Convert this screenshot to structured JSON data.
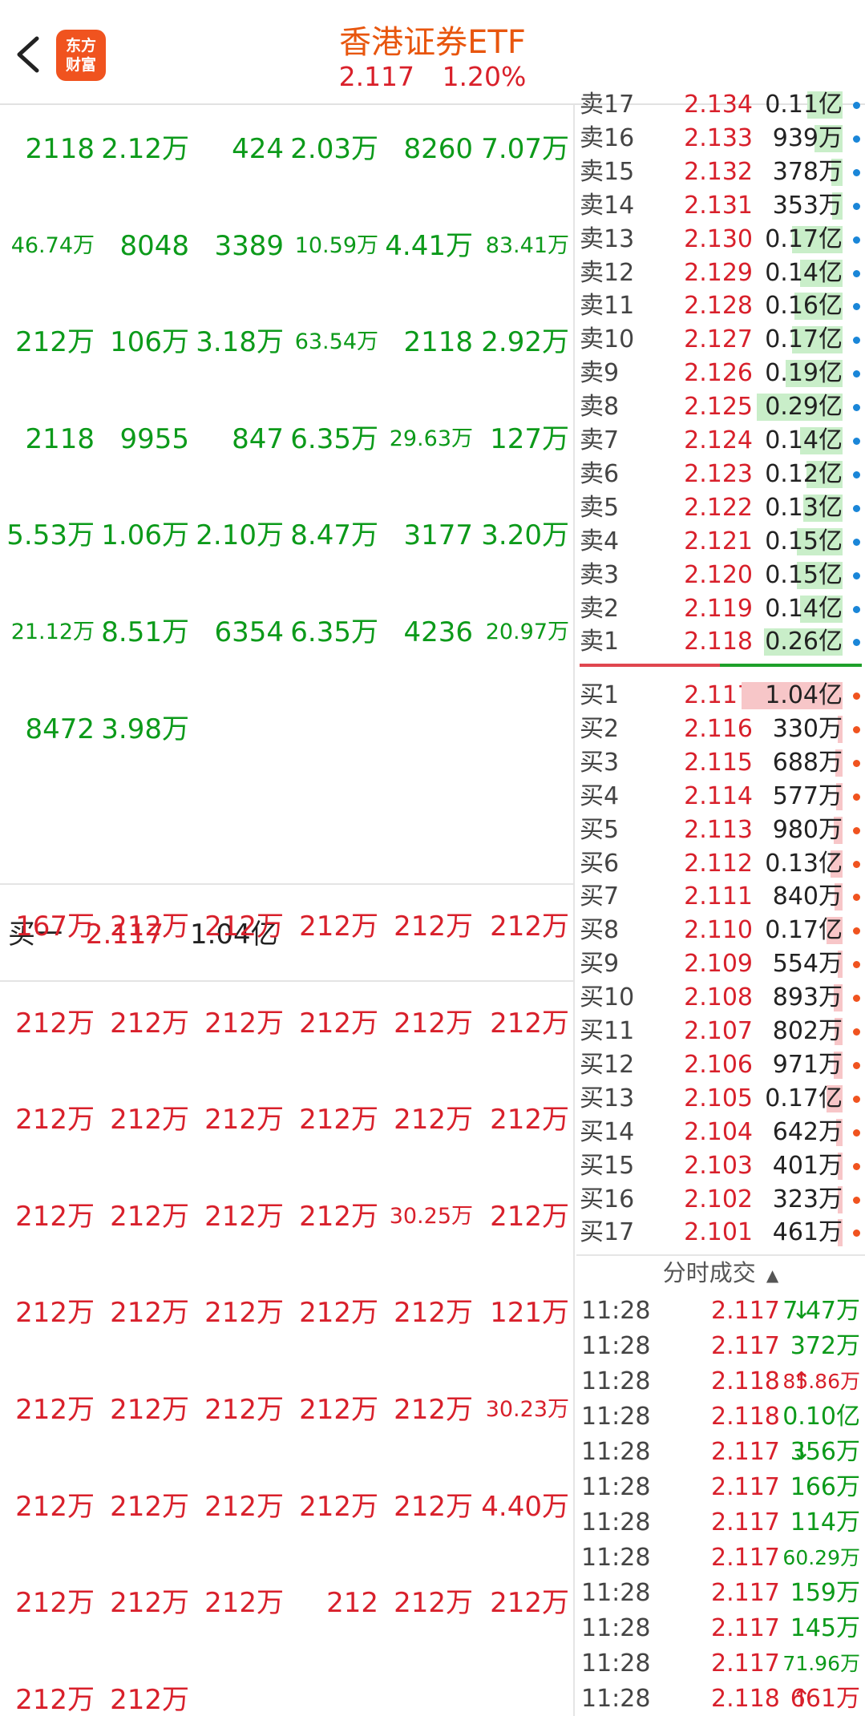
{
  "header": {
    "title": "香港证券ETF",
    "price": "2.117",
    "change_pct": "1.20%",
    "logo_text": [
      "东方",
      "财富"
    ]
  },
  "colors": {
    "up": "#d8202b",
    "down": "#0c9a1a",
    "accent": "#f0531f",
    "sell_dot": "#1a86d8"
  },
  "icons": {
    "back": "chevron-left-icon"
  },
  "sell_queue": [
    [
      "2118",
      "2.12万",
      "424",
      "2.03万",
      "8260",
      "7.07万"
    ],
    [
      "46.74万",
      "8048",
      "3389",
      "10.59万",
      "4.41万",
      "83.41万"
    ],
    [
      "212万",
      "106万",
      "3.18万",
      "63.54万",
      "2118",
      "2.92万"
    ],
    [
      "2118",
      "9955",
      "847",
      "6.35万",
      "29.63万",
      "127万"
    ],
    [
      "5.53万",
      "1.06万",
      "2.10万",
      "8.47万",
      "3177",
      "3.20万"
    ],
    [
      "21.12万",
      "8.51万",
      "6354",
      "6.35万",
      "4236",
      "20.97万"
    ],
    [
      "8472",
      "3.98万"
    ]
  ],
  "buy_one": {
    "label": "买一",
    "price": "2.117",
    "volume": "1.04亿"
  },
  "buy_queue": [
    [
      "167万",
      "212万",
      "212万",
      "212万",
      "212万",
      "212万"
    ],
    [
      "212万",
      "212万",
      "212万",
      "212万",
      "212万",
      "212万"
    ],
    [
      "212万",
      "212万",
      "212万",
      "212万",
      "212万",
      "212万"
    ],
    [
      "212万",
      "212万",
      "212万",
      "212万",
      "30.25万",
      "212万"
    ],
    [
      "212万",
      "212万",
      "212万",
      "212万",
      "212万",
      "121万"
    ],
    [
      "212万",
      "212万",
      "212万",
      "212万",
      "212万",
      "30.23万"
    ],
    [
      "212万",
      "212万",
      "212万",
      "212万",
      "212万",
      "4.40万"
    ],
    [
      "212万",
      "212万",
      "212万",
      "212",
      "212万",
      "212万"
    ],
    [
      "212万",
      "212万"
    ]
  ],
  "order_book": {
    "asks": [
      {
        "label": "卖17",
        "price": "2.134",
        "volume": "0.11亿",
        "level": 0.35
      },
      {
        "label": "卖16",
        "price": "2.133",
        "volume": "939万",
        "level": 0.28
      },
      {
        "label": "卖15",
        "price": "2.132",
        "volume": "378万",
        "level": 0.11
      },
      {
        "label": "卖14",
        "price": "2.131",
        "volume": "353万",
        "level": 0.1
      },
      {
        "label": "卖13",
        "price": "2.130",
        "volume": "0.17亿",
        "level": 0.5
      },
      {
        "label": "卖12",
        "price": "2.129",
        "volume": "0.14亿",
        "level": 0.42
      },
      {
        "label": "卖11",
        "price": "2.128",
        "volume": "0.16亿",
        "level": 0.48
      },
      {
        "label": "卖10",
        "price": "2.127",
        "volume": "0.17亿",
        "level": 0.5
      },
      {
        "label": "卖9",
        "price": "2.126",
        "volume": "0.19亿",
        "level": 0.56
      },
      {
        "label": "卖8",
        "price": "2.125",
        "volume": "0.29亿",
        "level": 0.85
      },
      {
        "label": "卖7",
        "price": "2.124",
        "volume": "0.14亿",
        "level": 0.42
      },
      {
        "label": "卖6",
        "price": "2.123",
        "volume": "0.12亿",
        "level": 0.36
      },
      {
        "label": "卖5",
        "price": "2.122",
        "volume": "0.13亿",
        "level": 0.39
      },
      {
        "label": "卖4",
        "price": "2.121",
        "volume": "0.15亿",
        "level": 0.45
      },
      {
        "label": "卖3",
        "price": "2.120",
        "volume": "0.15亿",
        "level": 0.45
      },
      {
        "label": "卖2",
        "price": "2.119",
        "volume": "0.14亿",
        "level": 0.42
      },
      {
        "label": "卖1",
        "price": "2.118",
        "volume": "0.26亿",
        "level": 0.78
      }
    ],
    "bids": [
      {
        "label": "买1",
        "price": "2.117",
        "volume": "1.04亿",
        "level": 1.0
      },
      {
        "label": "买2",
        "price": "2.116",
        "volume": "330万",
        "level": 0.03
      },
      {
        "label": "买3",
        "price": "2.115",
        "volume": "688万",
        "level": 0.07
      },
      {
        "label": "买4",
        "price": "2.114",
        "volume": "577万",
        "level": 0.06
      },
      {
        "label": "买5",
        "price": "2.113",
        "volume": "980万",
        "level": 0.09
      },
      {
        "label": "买6",
        "price": "2.112",
        "volume": "0.13亿",
        "level": 0.12
      },
      {
        "label": "买7",
        "price": "2.111",
        "volume": "840万",
        "level": 0.08
      },
      {
        "label": "买8",
        "price": "2.110",
        "volume": "0.17亿",
        "level": 0.16
      },
      {
        "label": "买9",
        "price": "2.109",
        "volume": "554万",
        "level": 0.05
      },
      {
        "label": "买10",
        "price": "2.108",
        "volume": "893万",
        "level": 0.09
      },
      {
        "label": "买11",
        "price": "2.107",
        "volume": "802万",
        "level": 0.08
      },
      {
        "label": "买12",
        "price": "2.106",
        "volume": "971万",
        "level": 0.09
      },
      {
        "label": "买13",
        "price": "2.105",
        "volume": "0.17亿",
        "level": 0.16
      },
      {
        "label": "买14",
        "price": "2.104",
        "volume": "642万",
        "level": 0.06
      },
      {
        "label": "买15",
        "price": "2.103",
        "volume": "401万",
        "level": 0.04
      },
      {
        "label": "买16",
        "price": "2.102",
        "volume": "323万",
        "level": 0.03
      },
      {
        "label": "买17",
        "price": "2.101",
        "volume": "461万",
        "level": 0.04
      }
    ]
  },
  "trades": {
    "header": "分时成交",
    "header_icon": "caret-up-icon",
    "rows": [
      {
        "time": "11:28",
        "price": "2.117",
        "dir": "down",
        "volume": "7.47万",
        "small": false
      },
      {
        "time": "11:28",
        "price": "2.117",
        "dir": "",
        "volume": "372万",
        "small": false
      },
      {
        "time": "11:28",
        "price": "2.118",
        "dir": "up",
        "volume": "85.86万",
        "small": true
      },
      {
        "time": "11:28",
        "price": "2.118",
        "dir": "",
        "volume": "0.10亿",
        "small": false
      },
      {
        "time": "11:28",
        "price": "2.117",
        "dir": "down",
        "volume": "356万",
        "small": false
      },
      {
        "time": "11:28",
        "price": "2.117",
        "dir": "",
        "volume": "166万",
        "small": false
      },
      {
        "time": "11:28",
        "price": "2.117",
        "dir": "",
        "volume": "114万",
        "small": false
      },
      {
        "time": "11:28",
        "price": "2.117",
        "dir": "",
        "volume": "60.29万",
        "small": true
      },
      {
        "time": "11:28",
        "price": "2.117",
        "dir": "",
        "volume": "159万",
        "small": false
      },
      {
        "time": "11:28",
        "price": "2.117",
        "dir": "",
        "volume": "145万",
        "small": false
      },
      {
        "time": "11:28",
        "price": "2.117",
        "dir": "",
        "volume": "71.96万",
        "small": true
      },
      {
        "time": "11:28",
        "price": "2.118",
        "dir": "up",
        "volume": "661万",
        "small": false
      }
    ]
  }
}
